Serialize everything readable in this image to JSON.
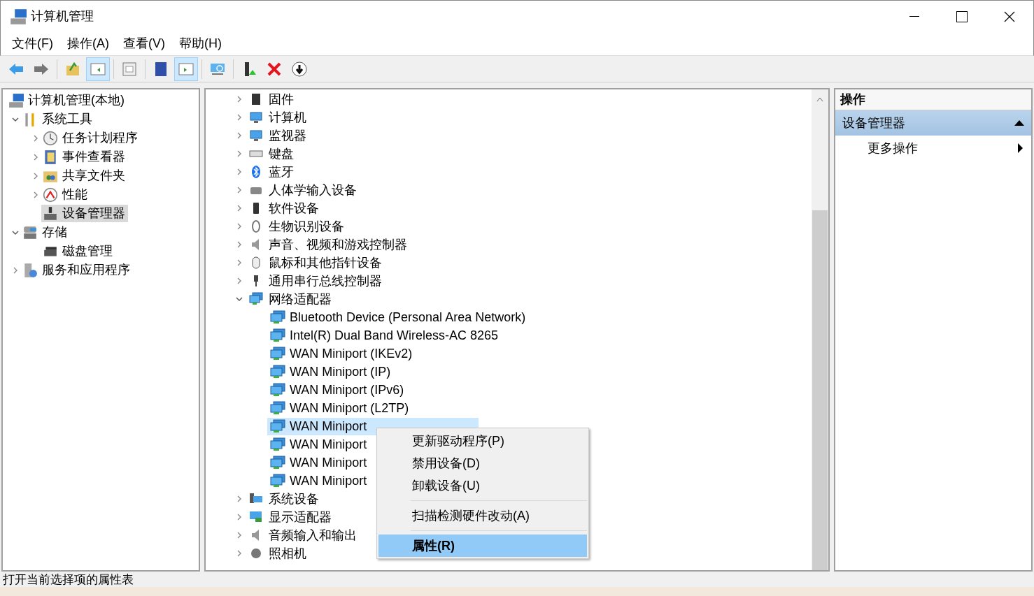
{
  "window": {
    "title": "计算机管理"
  },
  "menu_bar": [
    "文件(F)",
    "操作(A)",
    "查看(V)",
    "帮助(H)"
  ],
  "toolbar": [
    {
      "pressed": false
    },
    {
      "pressed": false
    },
    {
      "pressed": false
    },
    {
      "pressed": true
    },
    {
      "pressed": false
    },
    {
      "pressed": false
    },
    {
      "pressed": true
    },
    {
      "pressed": false
    },
    {
      "pressed": false
    },
    {
      "pressed": false
    },
    {
      "pressed": false
    }
  ],
  "nav_tree": [
    {
      "label": "计算机管理(本地)",
      "selected": false,
      "children": [
        {
          "label": "系统工具",
          "selected": false,
          "expanded": true,
          "children": [
            {
              "label": "任务计划程序",
              "selected": false,
              "expanded": false
            },
            {
              "label": "事件查看器",
              "selected": false,
              "expanded": false
            },
            {
              "label": "共享文件夹",
              "selected": false,
              "expanded": false
            },
            {
              "label": "性能",
              "selected": false,
              "expanded": false
            },
            {
              "label": "设备管理器",
              "selected": true
            }
          ]
        },
        {
          "label": "存储",
          "selected": false,
          "expanded": true,
          "children": [
            {
              "label": "磁盘管理",
              "selected": false
            }
          ]
        },
        {
          "label": "服务和应用程序",
          "selected": false,
          "expanded": false
        }
      ]
    }
  ],
  "device_tree": [
    {
      "label": "固件",
      "expanded": false
    },
    {
      "label": "计算机",
      "expanded": false
    },
    {
      "label": "监视器",
      "expanded": false
    },
    {
      "label": "键盘",
      "expanded": false
    },
    {
      "label": "蓝牙",
      "expanded": false
    },
    {
      "label": "人体学输入设备",
      "expanded": false
    },
    {
      "label": "软件设备",
      "expanded": false
    },
    {
      "label": "生物识别设备",
      "expanded": false
    },
    {
      "label": "声音、视频和游戏控制器",
      "expanded": false
    },
    {
      "label": "鼠标和其他指针设备",
      "expanded": false
    },
    {
      "label": "通用串行总线控制器",
      "expanded": false
    },
    {
      "label": "网络适配器",
      "expanded": true,
      "children": [
        {
          "label": "Bluetooth Device (Personal Area Network)",
          "selected": false
        },
        {
          "label": "Intel(R) Dual Band Wireless-AC 8265",
          "selected": false
        },
        {
          "label": "WAN Miniport (IKEv2)",
          "selected": false
        },
        {
          "label": "WAN Miniport (IP)",
          "selected": false
        },
        {
          "label": "WAN Miniport (IPv6)",
          "selected": false
        },
        {
          "label": "WAN Miniport (L2TP)",
          "selected": false
        },
        {
          "label": "WAN Miniport",
          "selected": true
        },
        {
          "label": "WAN Miniport",
          "selected": false
        },
        {
          "label": "WAN Miniport",
          "selected": false
        },
        {
          "label": "WAN Miniport",
          "selected": false
        }
      ]
    },
    {
      "label": "系统设备",
      "expanded": false
    },
    {
      "label": "显示适配器",
      "expanded": false
    },
    {
      "label": "音频输入和输出",
      "expanded": false
    },
    {
      "label": "照相机",
      "expanded": false
    }
  ],
  "context_menu": [
    {
      "label": "更新驱动程序(P)",
      "selected": false,
      "default": false,
      "separator_before": false
    },
    {
      "label": "禁用设备(D)",
      "selected": false,
      "default": false,
      "separator_before": false
    },
    {
      "label": "卸载设备(U)",
      "selected": false,
      "default": false,
      "separator_before": false
    },
    {
      "label": "扫描检测硬件改动(A)",
      "selected": false,
      "default": false,
      "separator_before": true
    },
    {
      "label": "属性(R)",
      "selected": true,
      "default": true,
      "separator_before": true
    }
  ],
  "actions_pane": {
    "title": "操作",
    "section": {
      "label": "设备管理器",
      "expanded": true
    },
    "items": [
      {
        "label": "更多操作"
      }
    ]
  },
  "status_bar": "打开当前选择项的属性表"
}
